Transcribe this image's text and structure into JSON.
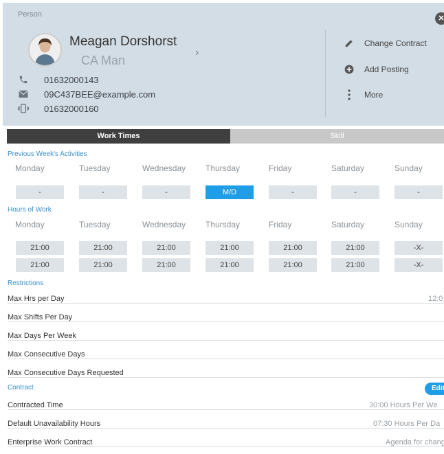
{
  "panel": {
    "title": "Person",
    "close_icon": "close-icon"
  },
  "person": {
    "name": "Meagan Dorshorst",
    "role": "CA Man",
    "phone": "01632000143",
    "email": "09C437BEE@example.com",
    "mobile": "01632000160"
  },
  "actions": [
    {
      "label": "Change Contract",
      "icon": "pencil-icon"
    },
    {
      "label": "Add Posting",
      "icon": "plus-circle-icon"
    },
    {
      "label": "More",
      "icon": "more-vertical-icon"
    }
  ],
  "tabs": [
    {
      "label": "Work Times",
      "active": true
    },
    {
      "label": "Skill",
      "active": false
    }
  ],
  "prev_week": {
    "heading": "Previous Week's Activities",
    "days": [
      "Monday",
      "Tuesday",
      "Wednesday",
      "Thursday",
      "Friday",
      "Saturday",
      "Sunday"
    ],
    "values": [
      "-",
      "-",
      "-",
      "M/D",
      "-",
      "-",
      "-"
    ]
  },
  "hours": {
    "heading": "Hours of Work",
    "days": [
      "Monday",
      "Tuesday",
      "Wednesday",
      "Thursday",
      "Friday",
      "Saturday",
      "Sunday"
    ],
    "row1": [
      "21:00",
      "21:00",
      "21:00",
      "21:00",
      "21:00",
      "21:00",
      "-X-"
    ],
    "row2": [
      "21:00",
      "21:00",
      "21:00",
      "21:00",
      "21:00",
      "21:00",
      "-X-"
    ]
  },
  "restrictions": {
    "heading": "Restrictions",
    "items": [
      {
        "label": "Max Hrs per Day",
        "value": "12:0"
      },
      {
        "label": "Max Shifts Per Day",
        "value": ""
      },
      {
        "label": "Max Days Per Week",
        "value": ""
      },
      {
        "label": "Max Consecutive Days",
        "value": ""
      },
      {
        "label": "Max Consecutive Days Requested",
        "value": ""
      }
    ]
  },
  "contract": {
    "heading": "Contract",
    "edit_label": "Edit",
    "items": [
      {
        "label": "Contracted Time",
        "value": "30:00 Hours Per We"
      },
      {
        "label": "Default Unavailability Hours",
        "value": "07:30 Hours Per Da"
      },
      {
        "label": "Enterprise Work Contract",
        "value": "Agenda for chang"
      }
    ]
  },
  "colors": {
    "header_bg": "#d3dde5",
    "accent": "#1f9ee7",
    "tab_active": "#3f3f3f"
  }
}
